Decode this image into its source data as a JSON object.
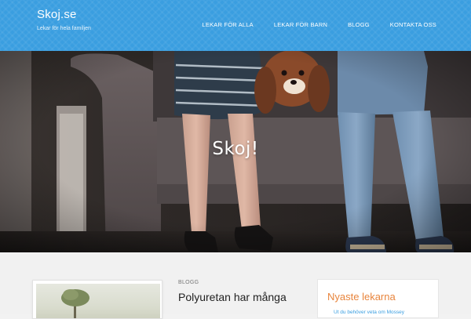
{
  "header": {
    "site_title": "Skoj.se",
    "tagline": "Lekar för hela familjen",
    "nav": [
      {
        "label": "LEKAR FÖR ALLA"
      },
      {
        "label": "LEKAR FÖR BARN"
      },
      {
        "label": "BLOGG"
      },
      {
        "label": "KONTAKTA OSS"
      }
    ]
  },
  "hero": {
    "title": "Skoj!",
    "image": "two children and a dog sitting on a grey sofa"
  },
  "post": {
    "category": "BLOGG",
    "title": "Polyuretan har många"
  },
  "sidebar": {
    "title": "Nyaste lekarna",
    "first_link": "Ut du behöver veta om Mossey"
  },
  "colors": {
    "header_blue": "#3a9ee0",
    "accent_orange": "#e8853d"
  }
}
